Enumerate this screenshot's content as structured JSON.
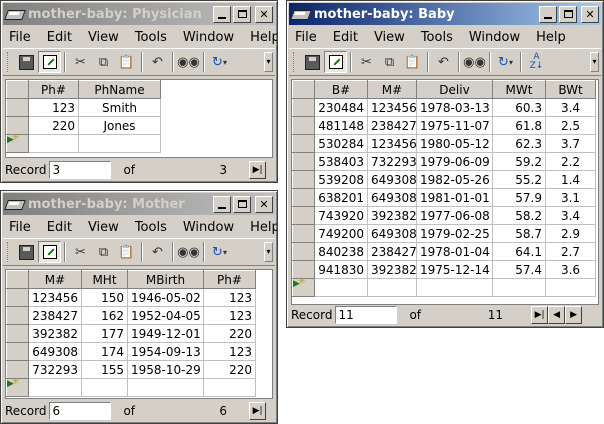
{
  "app_icon": "microscope-icon",
  "menus": [
    "File",
    "Edit",
    "View",
    "Tools",
    "Window",
    "Help"
  ],
  "toolbar_icons": [
    "save-icon",
    "design-view-icon",
    "cut-icon",
    "copy-icon",
    "paste-icon",
    "undo-icon",
    "find-icon",
    "hyperlink-icon",
    "sort-ascending-icon",
    "toolbar-options-icon"
  ],
  "colors": {
    "active_title": "#0a246a",
    "inactive_title": "#808080",
    "chrome": "#d4d0c8"
  },
  "physician": {
    "title": "mother-baby: Physician",
    "active": false,
    "columns": [
      "Ph#",
      "PhName"
    ],
    "rows": [
      [
        "123",
        "Smith"
      ],
      [
        "220",
        "Jones"
      ]
    ],
    "nav": {
      "label": "Record",
      "current": "3",
      "of": "of",
      "total": "3"
    }
  },
  "mother": {
    "title": "mother-baby: Mother",
    "active": false,
    "columns": [
      "M#",
      "MHt",
      "MBirth",
      "Ph#"
    ],
    "rows": [
      [
        "123456",
        "150",
        "1946-05-02",
        "123"
      ],
      [
        "238427",
        "162",
        "1952-04-05",
        "123"
      ],
      [
        "392382",
        "177",
        "1949-12-01",
        "220"
      ],
      [
        "649308",
        "174",
        "1954-09-13",
        "123"
      ],
      [
        "732293",
        "155",
        "1958-10-29",
        "220"
      ]
    ],
    "nav": {
      "label": "Record",
      "current": "6",
      "of": "of",
      "total": "6"
    }
  },
  "baby": {
    "title": "mother-baby: Baby",
    "active": true,
    "columns": [
      "B#",
      "M#",
      "Deliv",
      "MWt",
      "BWt"
    ],
    "rows": [
      [
        "230484",
        "123456",
        "1978-03-13",
        "60.3",
        "3.4"
      ],
      [
        "481148",
        "238427",
        "1975-11-07",
        "61.8",
        "2.5"
      ],
      [
        "530284",
        "123456",
        "1980-05-12",
        "62.3",
        "3.7"
      ],
      [
        "538403",
        "732293",
        "1979-06-09",
        "59.2",
        "2.2"
      ],
      [
        "539208",
        "649308",
        "1982-05-26",
        "55.2",
        "1.4"
      ],
      [
        "638201",
        "649308",
        "1981-01-01",
        "57.9",
        "3.1"
      ],
      [
        "743920",
        "392382",
        "1977-06-08",
        "58.2",
        "3.4"
      ],
      [
        "749200",
        "649308",
        "1979-02-25",
        "58.7",
        "2.9"
      ],
      [
        "840238",
        "238427",
        "1978-01-04",
        "64.1",
        "2.7"
      ],
      [
        "941830",
        "392382",
        "1975-12-14",
        "57.4",
        "3.6"
      ]
    ],
    "nav": {
      "label": "Record",
      "current": "11",
      "of": "of",
      "total": "11"
    }
  }
}
